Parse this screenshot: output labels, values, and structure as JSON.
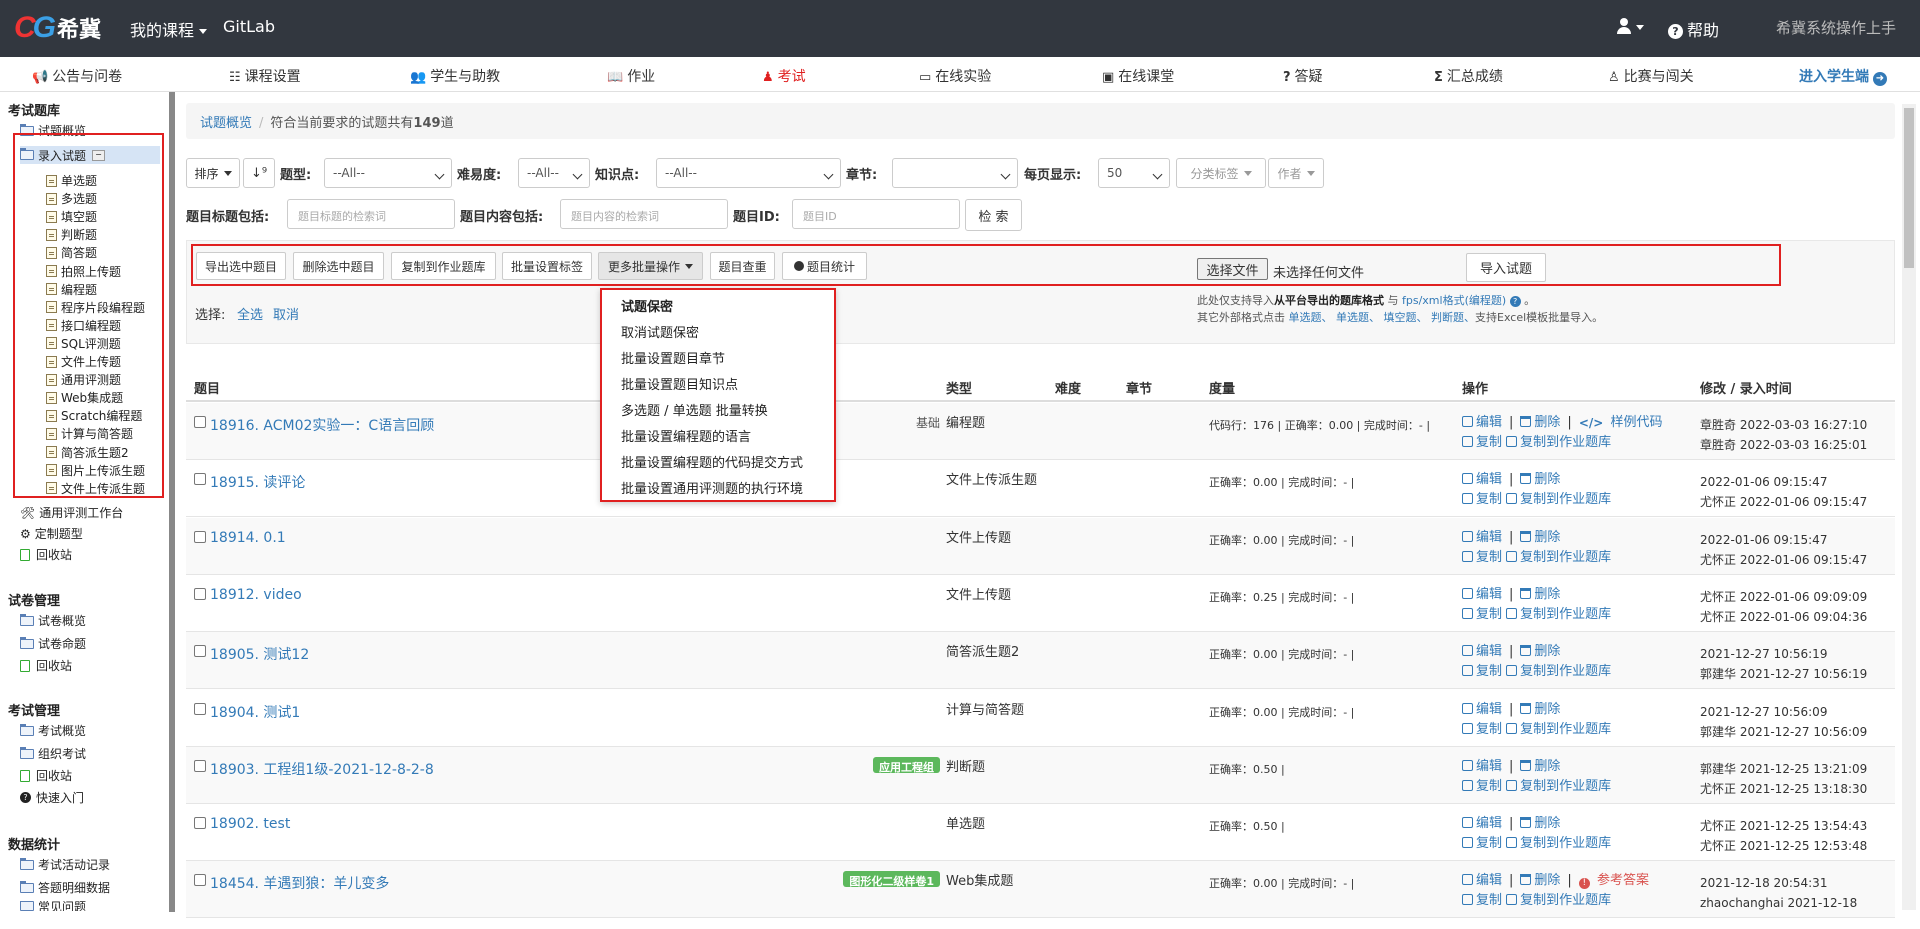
{
  "topbar": {
    "logo_text": "CG",
    "logo_brand": "希冀",
    "my_courses": "我的课程",
    "gitlab": "GitLab",
    "help": "帮助",
    "manual": "希冀系统操作上手"
  },
  "nav": {
    "items": [
      "公告与问卷",
      "课程设置",
      "学生与助教",
      "作业",
      "考试",
      "在线实验",
      "在线课堂",
      "答疑",
      "汇总成绩",
      "比赛与闯关"
    ],
    "icons": [
      "bullhorn-icon",
      "list-icon",
      "users-icon",
      "book-icon",
      "exam-icon",
      "laptop-icon",
      "classroom-icon",
      "question-icon",
      "sigma-icon",
      "trophy-icon"
    ],
    "active": "考试",
    "enter_student": "进入学生端",
    "accent": "#e02020",
    "link_color": "#337ab7"
  },
  "sidebar": {
    "sec1": "考试题库",
    "overview": "试题概览",
    "enter": "录入试题",
    "types": [
      "单选题",
      "多选题",
      "填空题",
      "判断题",
      "简答题",
      "拍照上传题",
      "编程题",
      "程序片段编程题",
      "接口编程题",
      "SQL评测题",
      "文件上传题",
      "通用评测题",
      "Web集成题",
      "Scratch编程题",
      "计算与简答题",
      "简答派生题2",
      "图片上传派生题",
      "文件上传派生题"
    ],
    "workbench": "通用评测工作台",
    "custom": "定制题型",
    "recycle": "回收站",
    "sec2": "试卷管理",
    "paper_overview": "试卷概览",
    "paper_compose": "试卷命题",
    "sec3": "考试管理",
    "exam_overview": "考试概览",
    "org_exam": "组织考试",
    "quick_start": "快速入门",
    "sec4": "数据统计",
    "exam_log": "考试活动记录",
    "answer_detail": "答题明细数据",
    "faq": "常见问题"
  },
  "breadcrumb": {
    "root": "试题概览",
    "info_prefix": "符合当前要求的试题共有",
    "count": "149",
    "info_suffix": "道"
  },
  "filters": {
    "sort": "排序",
    "type_label": "题型:",
    "type_value": "--All--",
    "difficulty_label": "难易度:",
    "difficulty_value": "--All--",
    "knowledge_label": "知识点:",
    "knowledge_value": "--All--",
    "chapter_label": "章节:",
    "chapter_value": "",
    "per_page_label": "每页显示:",
    "per_page_value": "50",
    "category_tag": "分类标签",
    "author": "作者",
    "title_label": "题目标题包括:",
    "title_placeholder": "题目标题的检索词",
    "content_label": "题目内容包括:",
    "content_placeholder": "题目内容的检索词",
    "id_label": "题目ID:",
    "id_placeholder": "题目ID",
    "search": "检 索"
  },
  "batch": {
    "export": "导出选中题目",
    "delete": "删除选中题目",
    "copy_to_bank": "复制到作业题库",
    "set_tags": "批量设置标签",
    "more": "更多批量操作",
    "dedupe": "题目查重",
    "stats": "题目统计",
    "choose_file": "选择文件",
    "no_file": "未选择任何文件",
    "import": "导入试题",
    "select_label": "选择:",
    "select_all": "全选",
    "select_cancel": "取消",
    "hint1_prefix": "此处仅支持导入",
    "hint1_bold": "从平台导出的题库格式",
    "hint1_mid": "与",
    "hint1_link": "fps/xml格式(编程题)",
    "hint2_prefix": "其它外部格式点击",
    "hint2_links": [
      "单选题、",
      "单选题、",
      "填空题、",
      "判断题、"
    ],
    "hint2_suffix": "支持Excel模板批量导入。"
  },
  "dropdown": {
    "items": [
      "试题保密",
      "取消试题保密",
      "批量设置题目章节",
      "批量设置题目知识点",
      "多选题 / 单选题 批量转换",
      "批量设置编程题的语言",
      "批量设置编程题的代码提交方式",
      "批量设置通用评测题的执行环境"
    ]
  },
  "table": {
    "headers": [
      "题目",
      "类型",
      "难度",
      "章节",
      "度量",
      "操作",
      "修改 / 录入时间"
    ],
    "edit": "编辑",
    "delete": "删除",
    "copy": "复制",
    "copy_to_bank": "复制到作业题库",
    "sample_code": "样例代码",
    "ref_answer": "参考答案",
    "rows": [
      {
        "title": "18916. ACM02实验一：C语言回顾",
        "tag": "基础",
        "type": "编程题",
        "metric": "代码行：176 | 正确率：0.00 | 完成时间：- |",
        "t1": "章胜奇 2022-03-03 16:27:10",
        "t2": "章胜奇 2022-03-03 16:25:01"
      },
      {
        "title": "18915. 读评论",
        "tag": "",
        "type": "文件上传派生题",
        "metric": "正确率：0.00 | 完成时间：- |",
        "t1": "2022-01-06 09:15:47",
        "t2": "尤怀正 2022-01-06 09:15:47"
      },
      {
        "title": "18914. 0.1",
        "tag": "",
        "type": "文件上传题",
        "metric": "正确率：0.00 | 完成时间：- |",
        "t1": "2022-01-06 09:15:47",
        "t2": "尤怀正 2022-01-06 09:15:47"
      },
      {
        "title": "18912. video",
        "tag": "",
        "type": "文件上传题",
        "metric": "正确率：0.25 | 完成时间：- |",
        "t1": "尤怀正 2022-01-06 09:09:09",
        "t2": "尤怀正 2022-01-06 09:04:36"
      },
      {
        "title": "18905. 测试12",
        "tag": "",
        "type": "简答派生题2",
        "metric": "正确率：0.00 | 完成时间：- |",
        "t1": "2021-12-27 10:56:19",
        "t2": "郭建华 2021-12-27 10:56:19"
      },
      {
        "title": "18904. 测试1",
        "tag": "",
        "type": "计算与简答题",
        "metric": "正确率：0.00 | 完成时间：- |",
        "t1": "2021-12-27 10:56:09",
        "t2": "郭建华 2021-12-27 10:56:09"
      },
      {
        "title": "18903. 工程组1级-2021-12-8-2-8",
        "tag": "应用工程组",
        "type": "判断题",
        "metric": "正确率：0.50 |",
        "t1": "郭建华 2021-12-25 13:21:09",
        "t2": "尤怀正 2021-12-25 13:18:30"
      },
      {
        "title": "18902. test",
        "tag": "",
        "type": "单选题",
        "metric": "正确率：0.50 |",
        "t1": "尤怀正 2021-12-25 13:54:43",
        "t2": "尤怀正 2021-12-25 12:53:48"
      },
      {
        "title": "18454. 羊遇到狼：羊儿变多",
        "tag": "图形化二级样卷1",
        "type": "Web集成题",
        "metric": "正确率：0.00 | 完成时间：- |",
        "t1": "2021-12-18 20:54:31",
        "t2": "zhaochanghai 2021-12-18"
      }
    ]
  }
}
